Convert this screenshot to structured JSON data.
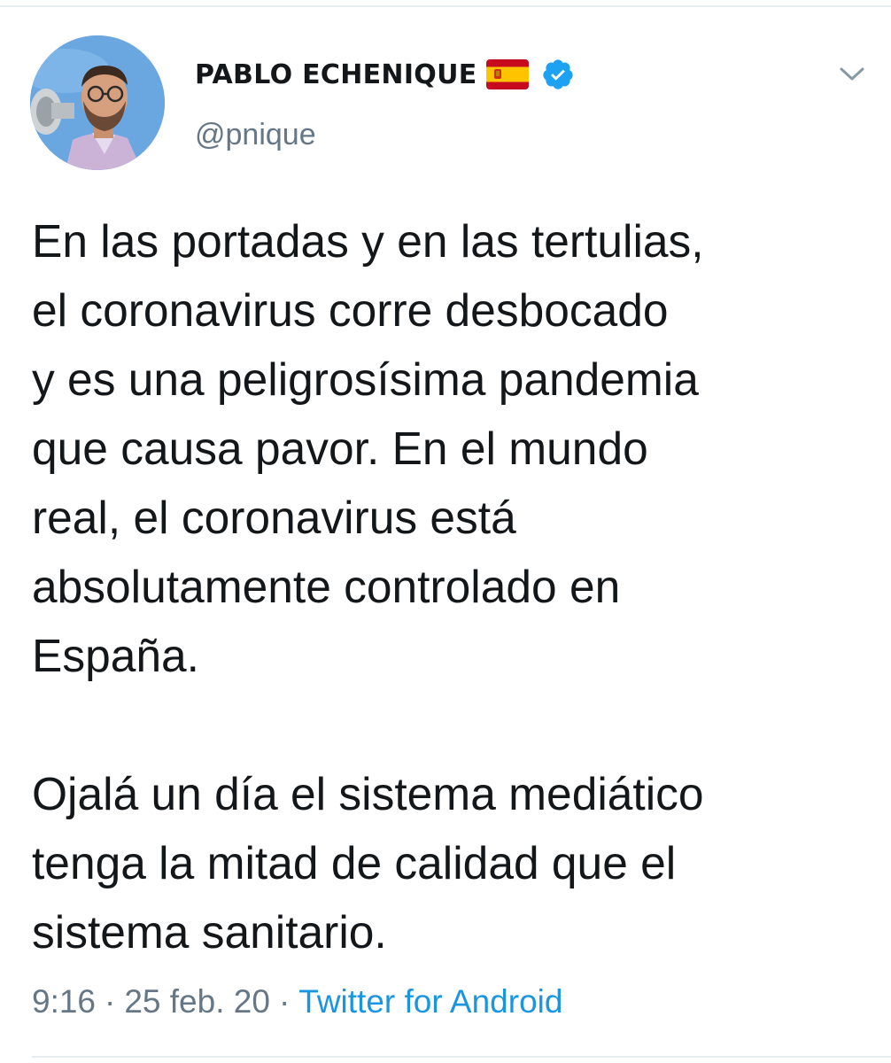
{
  "author": {
    "display_name": "PABLO ECHENIQUE",
    "handle": "@pnique",
    "flag": "spain-flag-icon",
    "verified": "verified-badge-icon",
    "avatar": "profile-photo"
  },
  "menu": {
    "icon": "chevron-down-icon"
  },
  "tweet": {
    "lines": [
      "En las portadas y en las tertulias,",
      "el coronavirus corre desbocado",
      "y es una peligrosísima pandemia",
      "que causa pavor. En el mundo",
      "real, el coronavirus está",
      "absolutamente controlado en",
      "España.",
      "",
      "Ojalá un día el sistema mediático",
      "tenga la mitad de calidad que el",
      "sistema sanitario."
    ]
  },
  "meta": {
    "time": "9:16",
    "separator": "·",
    "date": "25 feb. 20",
    "source": "Twitter for Android"
  },
  "colors": {
    "text": "#14171a",
    "secondary": "#657786",
    "link": "#1b95e0",
    "verified": "#1da1f2",
    "divider": "#e6ecf0"
  }
}
